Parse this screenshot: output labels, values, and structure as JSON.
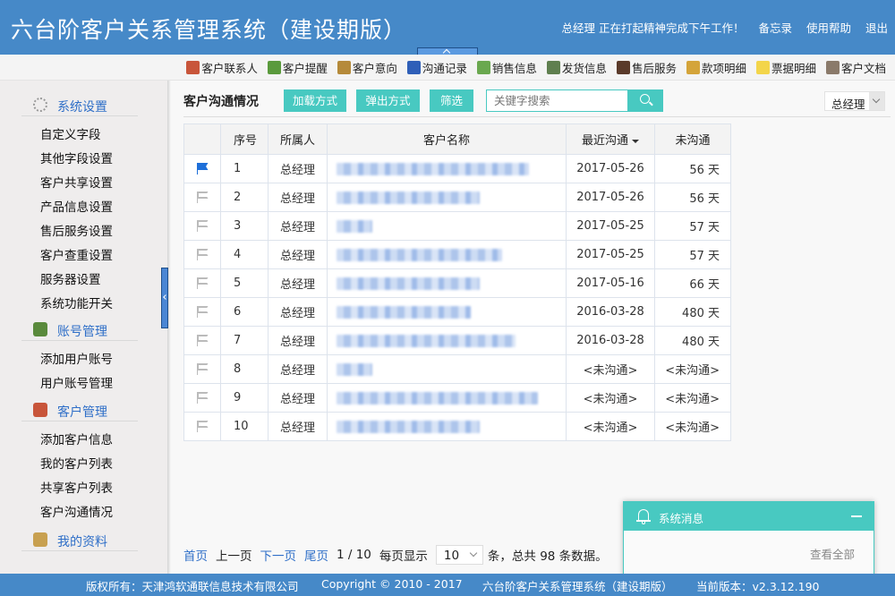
{
  "header": {
    "title": "六台阶客户关系管理系统（建设期版）",
    "greeting": "总经理 正在打起精神完成下午工作！",
    "links": [
      "备忘录",
      "使用帮助",
      "退出"
    ]
  },
  "toolbar": {
    "items": [
      {
        "label": "客户联系人",
        "icon": "contact-person-icon",
        "color": "#c8553a"
      },
      {
        "label": "客户提醒",
        "icon": "alarm-clock-icon",
        "color": "#5a9a3c"
      },
      {
        "label": "客户意向",
        "icon": "users-icon",
        "color": "#b58a3a"
      },
      {
        "label": "沟通记录",
        "icon": "telephone-icon",
        "color": "#2f5fb8"
      },
      {
        "label": "销售信息",
        "icon": "sales-document-icon",
        "color": "#6aa84f"
      },
      {
        "label": "发货信息",
        "icon": "delivery-truck-icon",
        "color": "#5f7f4f"
      },
      {
        "label": "售后服务",
        "icon": "service-agent-icon",
        "color": "#5a3a2a"
      },
      {
        "label": "款项明细",
        "icon": "coins-icon",
        "color": "#d4a43a"
      },
      {
        "label": "票据明细",
        "icon": "note-icon",
        "color": "#f3d54a"
      },
      {
        "label": "客户文档",
        "icon": "clipboard-icon",
        "color": "#8a7a6a"
      }
    ]
  },
  "sidebar": {
    "groups": [
      {
        "label": "系统设置",
        "icon": "gear-icon",
        "items": [
          "自定义字段",
          "其他字段设置",
          "客户共享设置",
          "产品信息设置",
          "售后服务设置",
          "客户查重设置",
          "服务器设置",
          "系统功能开关"
        ]
      },
      {
        "label": "账号管理",
        "icon": "user-account-icon",
        "items": [
          "添加用户账号",
          "用户账号管理"
        ]
      },
      {
        "label": "客户管理",
        "icon": "customer-icon",
        "items": [
          "添加客户信息",
          "我的客户列表",
          "共享客户列表",
          "客户沟通情况"
        ]
      },
      {
        "label": "我的资料",
        "icon": "briefcase-icon",
        "items": []
      }
    ]
  },
  "main": {
    "title": "客户沟通情况",
    "buttons": [
      "加载方式",
      "弹出方式",
      "筛选"
    ],
    "search_placeholder": "关键字搜索",
    "owner_filter": "总经理",
    "table": {
      "columns": [
        "",
        "序号",
        "所属人",
        "客户名称",
        "最近沟通",
        "未沟通"
      ],
      "sorted_column": "最近沟通",
      "rows": [
        {
          "flagged": true,
          "no": "1",
          "owner": "总经理",
          "name": "[blurred]",
          "last": "2017-05-26",
          "days": "56 天"
        },
        {
          "flagged": false,
          "no": "2",
          "owner": "总经理",
          "name": "[blurred]",
          "last": "2017-05-26",
          "days": "56 天"
        },
        {
          "flagged": false,
          "no": "3",
          "owner": "总经理",
          "name": "[blurred]",
          "last": "2017-05-25",
          "days": "57 天"
        },
        {
          "flagged": false,
          "no": "4",
          "owner": "总经理",
          "name": "[blurred]",
          "last": "2017-05-25",
          "days": "57 天"
        },
        {
          "flagged": false,
          "no": "5",
          "owner": "总经理",
          "name": "[blurred]",
          "last": "2017-05-16",
          "days": "66 天"
        },
        {
          "flagged": false,
          "no": "6",
          "owner": "总经理",
          "name": "[blurred]",
          "last": "2016-03-28",
          "days": "480 天"
        },
        {
          "flagged": false,
          "no": "7",
          "owner": "总经理",
          "name": "[blurred]",
          "last": "2016-03-28",
          "days": "480 天"
        },
        {
          "flagged": false,
          "no": "8",
          "owner": "总经理",
          "name": "[blurred]",
          "last": "<未沟通>",
          "days": "<未沟通>"
        },
        {
          "flagged": false,
          "no": "9",
          "owner": "总经理",
          "name": "[blurred]",
          "last": "<未沟通>",
          "days": "<未沟通>"
        },
        {
          "flagged": false,
          "no": "10",
          "owner": "总经理",
          "name": "[blurred]",
          "last": "<未沟通>",
          "days": "<未沟通>"
        }
      ]
    },
    "pager": {
      "first": "首页",
      "prev": "上一页",
      "next": "下一页",
      "last": "尾页",
      "position": "1 / 10",
      "per_page_label": "每页显示",
      "per_page": "10",
      "summary": "条，总共 98 条数据。"
    }
  },
  "message_box": {
    "title": "系统消息",
    "view_all": "查看全部"
  },
  "footer": {
    "owner": "版权所有：天津鸿软通联信息技术有限公司",
    "copyright": "Copyright © 2010 - 2017",
    "product": "六台阶客户关系管理系统（建设期版）",
    "version": "当前版本：v2.3.12.190"
  }
}
